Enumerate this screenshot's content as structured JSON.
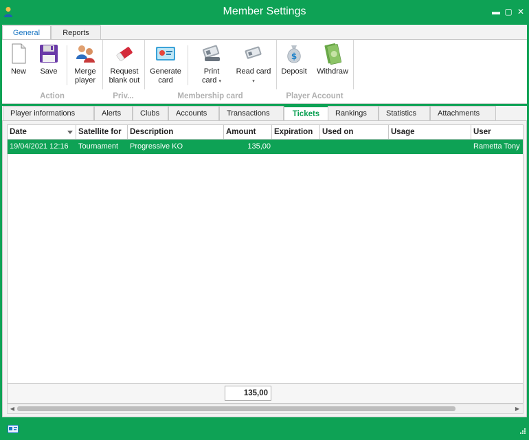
{
  "window": {
    "title": "Member Settings",
    "controls": {
      "minimize": "▬",
      "maximize": "▢",
      "close": "✕"
    }
  },
  "ribbon_tabs": [
    {
      "label": "General",
      "active": true
    },
    {
      "label": "Reports",
      "active": false
    }
  ],
  "ribbon": {
    "buttons": {
      "new": "New",
      "save": "Save",
      "merge_1": "Merge",
      "merge_2": "player",
      "request_1": "Request",
      "request_2": "blank out",
      "generate_1": "Generate",
      "generate_2": "card",
      "print_1": "Print",
      "print_2": "card",
      "read_1": "Read card",
      "deposit": "Deposit",
      "withdraw": "Withdraw"
    },
    "groups": {
      "action": "Action",
      "priv": "Priv...",
      "membership": "Membership card",
      "player_account": "Player Account"
    },
    "caret": "▾"
  },
  "content_tabs": [
    "Player informations",
    "Alerts",
    "Clubs",
    "Accounts",
    "Transactions",
    "Tickets",
    "Rankings",
    "Statistics",
    "Attachments"
  ],
  "active_tab": "Tickets",
  "grid": {
    "columns": [
      "Date",
      "Satellite for",
      "Description",
      "Amount",
      "Expiration",
      "Used on",
      "Usage",
      "User"
    ],
    "rows": [
      {
        "date": "19/04/2021 12:16",
        "satellite_for": "Tournament",
        "description": "Progressive KO",
        "amount": "135,00",
        "expiration": "",
        "used_on": "",
        "usage": "",
        "user": "Rametta Tony"
      }
    ],
    "total_amount": "135,00"
  },
  "scrollbar": {
    "left_arrow": "◀",
    "right_arrow": "▶"
  },
  "colors": {
    "accent": "#0ea255",
    "selected_row": "#0ea255",
    "text_link": "#1c77c3"
  }
}
